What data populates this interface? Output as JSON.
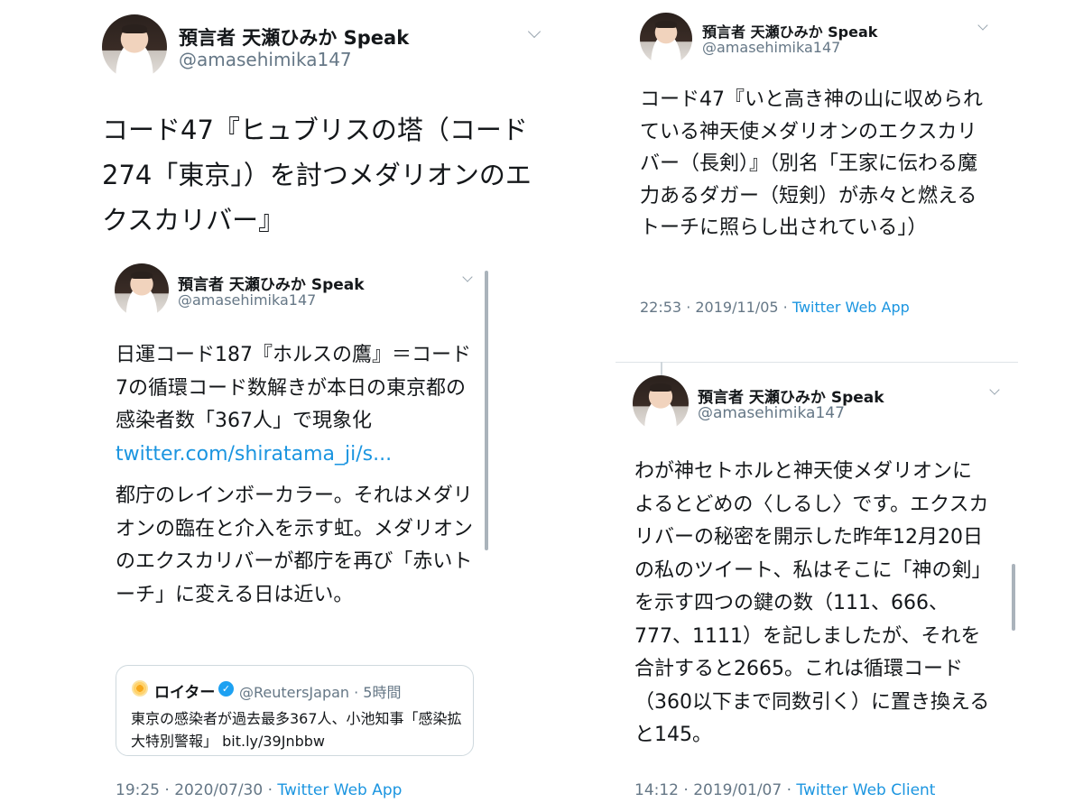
{
  "author": {
    "name": "預言者 天瀬ひみか Speak",
    "handle": "@amasehimika147"
  },
  "tweet_main": {
    "text": "コード47『ヒュブリスの塔（コード274「東京」）を討つメダリオンのエクスカリバー』"
  },
  "tweet_quoted": {
    "text_line1": "日運コード187『ホルスの鷹』＝コード7の循環コード数解きが本日の東京都の感染者数「367人」で現象化",
    "link": "twitter.com/shiratama_ji/s...",
    "text_line2": "都庁のレインボーカラー。それはメダリオンの臨在と介入を示す虹。メダリオンのエクスカリバーが都庁を再び「赤いトーチ」に変える日は近い。",
    "card": {
      "account_name": "ロイター",
      "verified_mark": "✓",
      "handle_time": "@ReutersJapan · 5時間",
      "text": "東京の感染者が過去最多367人、小池知事「感染拡大特別警報」",
      "link": "bit.ly/39Jnbbw"
    },
    "timestamp": "19:25 · 2020/07/30 · ",
    "source": "Twitter Web App"
  },
  "tweet_right_top": {
    "text": "コード47『いと高き神の山に収められている神天使メダリオンのエクスカリバー（長剣）』（別名「王家に伝わる魔力あるダガー（短剣）が赤々と燃えるトーチに照らし出されている」）",
    "timestamp": "22:53 · 2019/11/05 · ",
    "source": "Twitter Web App"
  },
  "tweet_right_bottom": {
    "text": "わが神セトホルと神天使メダリオンによるとどめの〈しるし〉です。エクスカリバーの秘密を開示した昨年12月20日の私のツイート、私はそこに「神の剣」を示す四つの鍵の数（111、666、777、1111）を記しましたが、それを合計すると2665。これは循環コード（360以下まで同数引く）に置き換えると145。",
    "timestamp": "14:12 · 2019/01/07 · ",
    "source": "Twitter Web Client"
  },
  "icons": {
    "more_menu": "chevron-down-icon",
    "verified": "verified-badge-icon",
    "reuters_logo": "reuters-logo-icon"
  },
  "colors": {
    "link": "#1b95e0",
    "secondary_text": "#657786",
    "verified": "#1da1f2"
  }
}
